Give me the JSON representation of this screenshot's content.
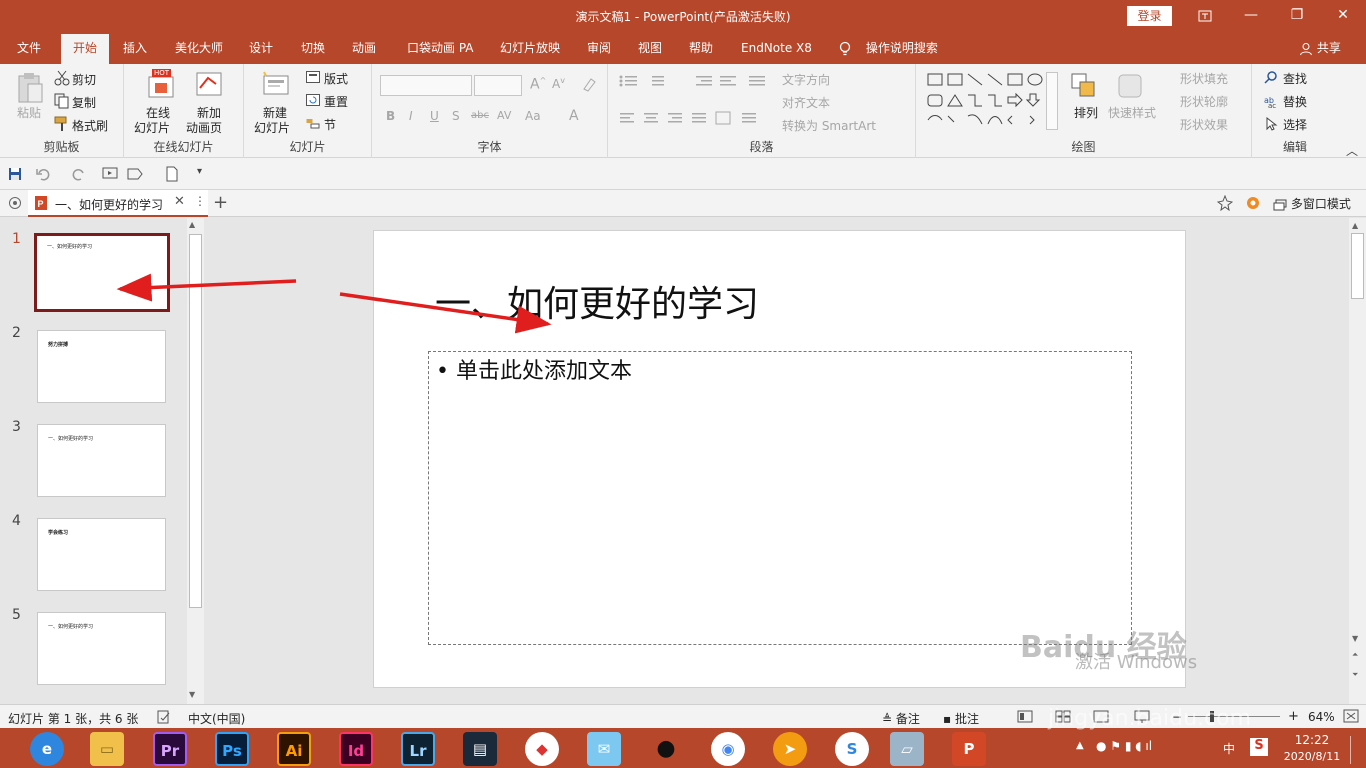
{
  "window": {
    "title": "演示文稿1  -  PowerPoint(产品激活失败)",
    "login_label": "登录",
    "restore_icon": "ribbon-display-icon",
    "minimize_glyph": "—",
    "maximize_glyph": "❐",
    "close_glyph": "✕"
  },
  "tabs": [
    {
      "label": "文件"
    },
    {
      "label": "开始"
    },
    {
      "label": "插入"
    },
    {
      "label": "美化大师"
    },
    {
      "label": "设计"
    },
    {
      "label": "切换"
    },
    {
      "label": "动画"
    },
    {
      "label": "口袋动画 PA"
    },
    {
      "label": "幻灯片放映"
    },
    {
      "label": "审阅"
    },
    {
      "label": "视图"
    },
    {
      "label": "帮助"
    },
    {
      "label": "EndNote X8"
    },
    {
      "label": "操作说明搜索"
    },
    {
      "label": "共享"
    }
  ],
  "ribbon": {
    "clipboard": {
      "paste": "粘贴",
      "cut": "剪切",
      "copy": "复制",
      "format_painter": "格式刷",
      "label": "剪贴板"
    },
    "online_slides": {
      "online_line1": "在线",
      "online_line2": "幻灯片",
      "anim_line1": "新加",
      "anim_line2": "动画页",
      "label": "在线幻灯片",
      "hot_badge": "HOT"
    },
    "slides": {
      "new_line1": "新建",
      "new_line2": "幻灯片",
      "layout": "版式",
      "reset": "重置",
      "section": "节",
      "label": "幻灯片"
    },
    "font": {
      "bold": "B",
      "italic": "I",
      "underline": "U",
      "shadow": "S",
      "strike": "abc",
      "spacing": "AV",
      "case": "Aa",
      "color": "A",
      "label": "字体"
    },
    "paragraph": {
      "text_direction": "文字方向",
      "align_text": "对齐文本",
      "smartart": "转换为 SmartArt",
      "label": "段落"
    },
    "drawing": {
      "arrange": "排列",
      "quick_styles": "快速样式",
      "shape_fill": "形状填充",
      "shape_outline": "形状轮廓",
      "shape_effects": "形状效果",
      "label": "绘图"
    },
    "editing": {
      "find": "查找",
      "replace": "替换",
      "select": "选择",
      "label": "编辑"
    }
  },
  "doc_tabs": {
    "active": "一、如何更好的学习",
    "multi_window": "多窗口模式"
  },
  "thumbnails": [
    {
      "num": "1",
      "text": "一、如何更好的学习"
    },
    {
      "num": "2",
      "text": "努力拼搏"
    },
    {
      "num": "3",
      "text": "一、如何更好的学习"
    },
    {
      "num": "4",
      "text": "学会练习"
    },
    {
      "num": "5",
      "text": "一、如何更好的学习"
    }
  ],
  "slide": {
    "title": "一、如何更好的学习",
    "body_placeholder": "• 单击此处添加文本"
  },
  "status": {
    "slide_info": "幻灯片 第 1 张，共 6 张",
    "language": "中文(中国)",
    "notes": "备注",
    "comments": "批注",
    "zoom": "64%"
  },
  "taskbar": {
    "apps": [
      "Pr",
      "Ps",
      "Ai",
      "Id",
      "Lr"
    ],
    "time": "12:22",
    "date": "2020/8/11",
    "ime": "中"
  },
  "overlay": {
    "activate_windows": "激活 Windows",
    "watermark": "Baidu 经验",
    "watermark_url": "jingyan.baidu.com"
  },
  "colors": {
    "accent": "#b7472a",
    "arrow": "#e11e1e",
    "selected_thumb": "#7b1b1b"
  }
}
